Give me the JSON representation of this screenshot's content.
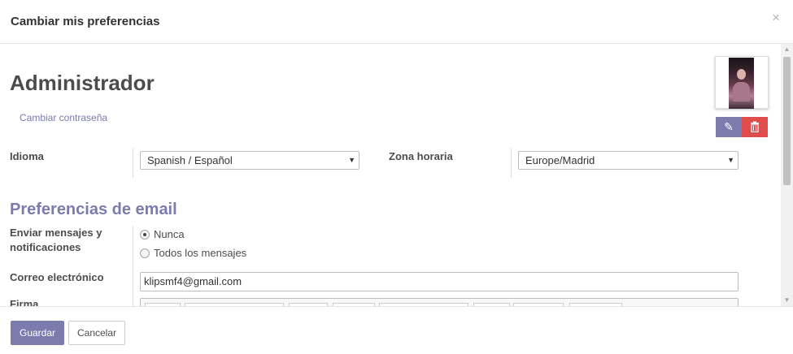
{
  "dialog": {
    "title": "Cambiar mis preferencias",
    "close_glyph": "×"
  },
  "user": {
    "name": "Administrador",
    "change_password_link": "Cambiar contraseña"
  },
  "avatar": {
    "edit_icon": "pencil-icon",
    "delete_icon": "trash-icon",
    "edit_glyph": "✎",
    "delete_glyph": "🗑"
  },
  "fields": {
    "language": {
      "label": "Idioma",
      "value": "Spanish / Español"
    },
    "timezone": {
      "label": "Zona horaria",
      "value": "Europe/Madrid"
    },
    "notifications": {
      "label": "Enviar mensajes y notificaciones",
      "options": [
        {
          "label": "Nunca",
          "checked": true
        },
        {
          "label": "Todos los mensajes",
          "checked": false
        }
      ]
    },
    "email": {
      "label": "Correo electrónico",
      "value": "klipsmf4@gmail.com"
    },
    "signature": {
      "label": "Firma"
    }
  },
  "section": {
    "email_prefs_title": "Preferencias de email"
  },
  "footer": {
    "save_label": "Guardar",
    "cancel_label": "Cancelar"
  },
  "colors": {
    "accent": "#7c7bad",
    "danger": "#e04c4c",
    "text": "#4c4c4c"
  }
}
